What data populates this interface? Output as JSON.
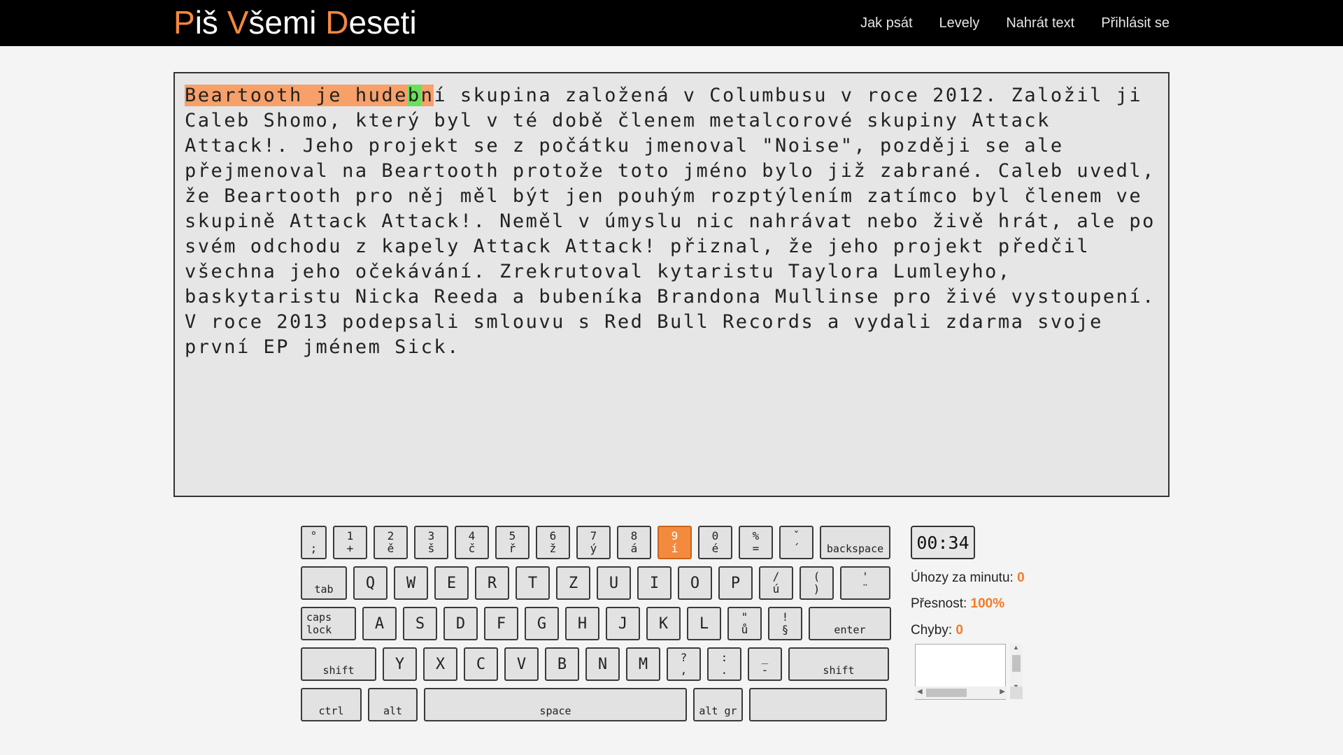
{
  "header": {
    "logo": {
      "p1a": "P",
      "p1b": "iš ",
      "p2a": "V",
      "p2b": "šemi ",
      "p3a": "D",
      "p3b": "eseti"
    },
    "nav": [
      "Jak psát",
      "Levely",
      "Nahrát text",
      "Přihlásit se"
    ]
  },
  "text": {
    "typed": "Beartooth je hude",
    "current": "b",
    "typed_tail": "n",
    "rest": "í skupina založená v Columbusu v roce 2012. Založil ji Caleb Shomo, který byl v té době členem metalcorové skupiny Attack Attack!. Jeho projekt se z počátku jmenoval \"Noise\", později se ale přejmenoval na Beartooth protože toto jméno bylo již zabrané. Caleb uvedl, že Beartooth pro něj měl být jen pouhým rozptýlením zatímco byl členem ve skupině Attack Attack!. Neměl v úmyslu nic nahrávat nebo živě hrát, ale po svém odchodu z kapely Attack Attack! přiznal, že jeho projekt předčil všechna jeho očekávání. Zrekrutoval kytaristu Taylora Lumleyho, baskytaristu Nicka Reeda a bubeníka Brandona Mullinse pro živé vystoupení. V roce 2013 podepsali smlouvu s Red Bull Records a vydali zdarma svoje první EP jménem Sick."
  },
  "keyboard": {
    "highlight_color": "#f48a3e",
    "row1": [
      {
        "top": "°",
        "bottom": ";"
      },
      {
        "top": "1",
        "bottom": "+"
      },
      {
        "top": "2",
        "bottom": "ě"
      },
      {
        "top": "3",
        "bottom": "š"
      },
      {
        "top": "4",
        "bottom": "č"
      },
      {
        "top": "5",
        "bottom": "ř"
      },
      {
        "top": "6",
        "bottom": "ž"
      },
      {
        "top": "7",
        "bottom": "ý"
      },
      {
        "top": "8",
        "bottom": "á"
      },
      {
        "top": "9",
        "bottom": "í"
      },
      {
        "top": "0",
        "bottom": "é"
      },
      {
        "top": "%",
        "bottom": "="
      },
      {
        "top": "ˇ",
        "bottom": "´"
      }
    ],
    "backspace": "backspace",
    "tab": "tab",
    "row2": [
      "Q",
      "W",
      "E",
      "R",
      "T",
      "Z",
      "U",
      "I",
      "O",
      "P"
    ],
    "row2_dual": [
      {
        "top": "/",
        "bottom": "ú"
      },
      {
        "top": "(",
        "bottom": ")"
      },
      {
        "top": "'",
        "bottom": "¨"
      }
    ],
    "caps": "caps lock",
    "row3": [
      "A",
      "S",
      "D",
      "F",
      "G",
      "H",
      "J",
      "K",
      "L"
    ],
    "row3_dual": [
      {
        "top": "\"",
        "bottom": "ů"
      },
      {
        "top": "!",
        "bottom": "§"
      }
    ],
    "enter": "enter",
    "shift": "shift",
    "row4": [
      "Y",
      "X",
      "C",
      "V",
      "B",
      "N",
      "M"
    ],
    "row4_dual": [
      {
        "top": "?",
        "bottom": ","
      },
      {
        "top": ":",
        "bottom": "."
      },
      {
        "top": "_",
        "bottom": "-"
      }
    ],
    "ctrl": "ctrl",
    "alt": "alt",
    "space": "space",
    "altgr": "alt gr"
  },
  "stats": {
    "timer": "00:34",
    "wpm_label": "Úhozy za minutu: ",
    "wpm": "0",
    "acc_label": "Přesnost: ",
    "acc": "100%",
    "err_label": "Chyby: ",
    "err": "0"
  }
}
